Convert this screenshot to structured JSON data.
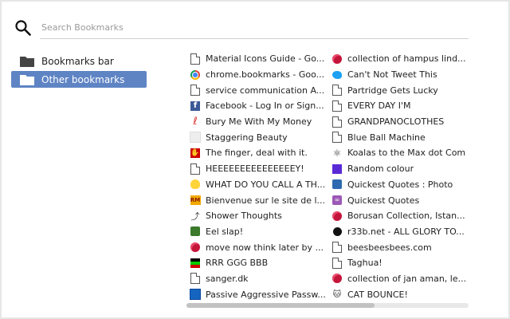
{
  "search": {
    "placeholder": "Search Bookmarks"
  },
  "sidebar": {
    "folders": [
      {
        "label": "Bookmarks bar"
      },
      {
        "label": "Other bookmarks"
      }
    ]
  },
  "bookmarks": {
    "left": [
      {
        "label": "Material Icons Guide - Go...",
        "icon": "page-icon"
      },
      {
        "label": "chrome.bookmarks - Goo...",
        "icon": "chrome-icon"
      },
      {
        "label": "service communication A...",
        "icon": "page-icon"
      },
      {
        "label": "Facebook - Log In or Sign...",
        "icon": "facebook-icon"
      },
      {
        "label": "Bury Me With My Money",
        "icon": "swirl-icon"
      },
      {
        "label": "Staggering Beauty",
        "icon": "blank-icon"
      },
      {
        "label": "The finger, deal with it.",
        "icon": "finger-icon"
      },
      {
        "label": "HEEEEEEEEEEEEEEEY!",
        "icon": "page-icon"
      },
      {
        "label": "WHAT DO YOU CALL A TH...",
        "icon": "duck-icon"
      },
      {
        "label": "Bienvenue sur le site de l...",
        "icon": "rm-icon"
      },
      {
        "label": "Shower Thoughts",
        "icon": "shower-icon"
      },
      {
        "label": "Eel slap!",
        "icon": "face-icon"
      },
      {
        "label": "move now think later by ...",
        "icon": "rose-icon"
      },
      {
        "label": "RRR GGG BBB",
        "icon": "rgb-icon"
      },
      {
        "label": "sanger.dk",
        "icon": "page-icon"
      },
      {
        "label": "Passive Aggressive Passw...",
        "icon": "blue-icon"
      }
    ],
    "right": [
      {
        "label": "collection of hampus lind...",
        "icon": "rose-icon"
      },
      {
        "label": "Can't Not Tweet This",
        "icon": "twitter-icon"
      },
      {
        "label": "Partridge Gets Lucky",
        "icon": "page-icon"
      },
      {
        "label": "EVERY DAY I'M",
        "icon": "page-icon"
      },
      {
        "label": "GRANDPANOCLOTHES",
        "icon": "page-icon"
      },
      {
        "label": "Blue Ball Machine",
        "icon": "page-icon"
      },
      {
        "label": "Koalas to the Max dot Com",
        "icon": "atom-icon"
      },
      {
        "label": "Random colour",
        "icon": "purple-icon"
      },
      {
        "label": "Quickest Quotes : Photo",
        "icon": "quote-icon"
      },
      {
        "label": "Quickest Quotes",
        "icon": "quote2-icon"
      },
      {
        "label": "Borusan Collection, Istan...",
        "icon": "rose-icon"
      },
      {
        "label": "r33b.net - ALL GLORY TO...",
        "icon": "bomb-icon"
      },
      {
        "label": "beesbeesbees.com",
        "icon": "page-icon"
      },
      {
        "label": "Taghua!",
        "icon": "page-icon"
      },
      {
        "label": "collection of jan aman, le...",
        "icon": "rose-icon"
      },
      {
        "label": "CAT BOUNCE!",
        "icon": "cat-icon"
      }
    ]
  },
  "colors": {
    "selection": "#5f84c4"
  }
}
